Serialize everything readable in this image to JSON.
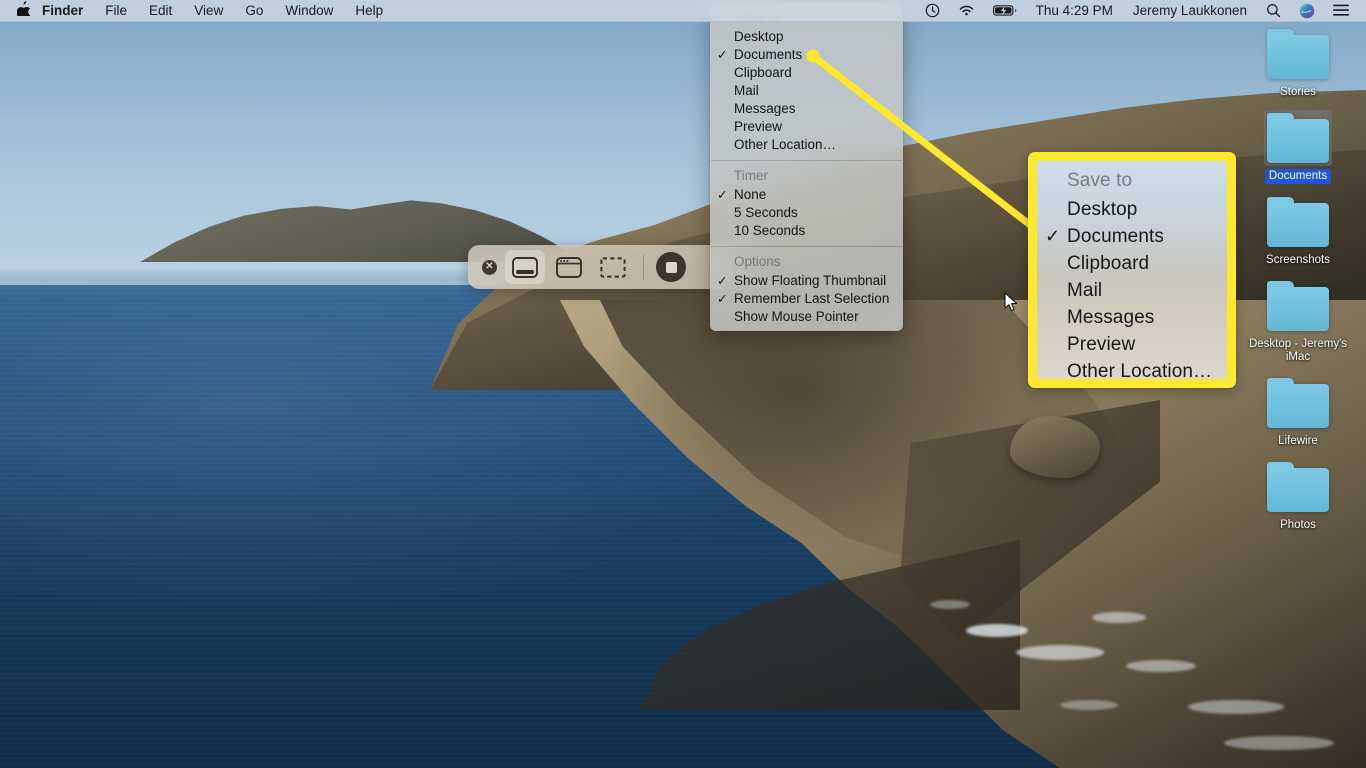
{
  "menubar": {
    "apple_glyph": "",
    "items": [
      {
        "label": "Finder",
        "bold": true
      },
      {
        "label": "File",
        "bold": false
      },
      {
        "label": "Edit",
        "bold": false
      },
      {
        "label": "View",
        "bold": false
      },
      {
        "label": "Go",
        "bold": false
      },
      {
        "label": "Window",
        "bold": false
      },
      {
        "label": "Help",
        "bold": false
      }
    ],
    "status_icons": [
      "time-machine-icon",
      "wifi-icon",
      "battery-icon"
    ],
    "clock": "Thu 4:29 PM",
    "user": "Jeremy Laukkonen",
    "right_icons": [
      "search-icon",
      "siri-icon",
      "control-center-icon"
    ]
  },
  "capture_toolbar": {
    "close_label": "✕",
    "buttons": [
      {
        "name": "capture-entire-screen",
        "selected": true
      },
      {
        "name": "capture-selected-window",
        "selected": false
      },
      {
        "name": "capture-selected-portion",
        "selected": false
      }
    ],
    "record_button": "record-selected-portion"
  },
  "options_menu": {
    "sections": [
      {
        "header": "Save to",
        "items": [
          {
            "label": "Desktop",
            "checked": false
          },
          {
            "label": "Documents",
            "checked": true
          },
          {
            "label": "Clipboard",
            "checked": false
          },
          {
            "label": "Mail",
            "checked": false
          },
          {
            "label": "Messages",
            "checked": false
          },
          {
            "label": "Preview",
            "checked": false
          },
          {
            "label": "Other Location…",
            "checked": false
          }
        ]
      },
      {
        "header": "Timer",
        "items": [
          {
            "label": "None",
            "checked": true
          },
          {
            "label": "5 Seconds",
            "checked": false
          },
          {
            "label": "10 Seconds",
            "checked": false
          }
        ]
      },
      {
        "header": "Options",
        "items": [
          {
            "label": "Show Floating Thumbnail",
            "checked": true
          },
          {
            "label": "Remember Last Selection",
            "checked": true
          },
          {
            "label": "Show Mouse Pointer",
            "checked": false
          }
        ]
      }
    ],
    "checkmark": "✓"
  },
  "callout": {
    "border_color": "#ffe92e",
    "header": "Save to",
    "items": [
      {
        "label": "Desktop",
        "checked": false
      },
      {
        "label": "Documents",
        "checked": true
      },
      {
        "label": "Clipboard",
        "checked": false
      },
      {
        "label": "Mail",
        "checked": false
      },
      {
        "label": "Messages",
        "checked": false
      },
      {
        "label": "Preview",
        "checked": false
      },
      {
        "label": "Other Location…",
        "checked": false
      }
    ],
    "checkmark": "✓"
  },
  "desktop_icons": [
    {
      "label": "Stories",
      "selected": false
    },
    {
      "label": "Documents",
      "selected": true
    },
    {
      "label": "Screenshots",
      "selected": false
    },
    {
      "label": "Desktop - Jeremy's iMac",
      "selected": false
    },
    {
      "label": "Lifewire",
      "selected": false
    },
    {
      "label": "Photos",
      "selected": false
    }
  ]
}
